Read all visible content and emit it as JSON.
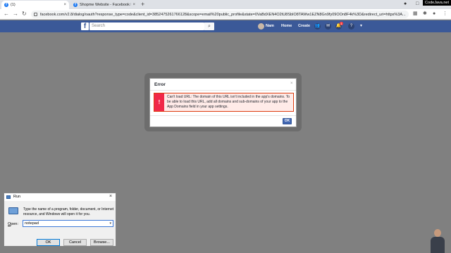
{
  "browser": {
    "tabs": [
      {
        "title": "(1)",
        "favicon": "facebook-icon"
      },
      {
        "title": "Shopme Website - Facebook Log",
        "favicon": "facebook-icon"
      }
    ],
    "new_tab_symbol": "+",
    "url_host": "facebook.com",
    "url_path": "/v2.8/dialog/oauth?response_type=code&client_id=3852475261766128&scope=email%20public_profile&state=0VaBdXEN4O2tU8SbIO8TAWw1EZN8Gn9fy09OOn8F4k%3D&redirect_uri=https%3A...",
    "watermark": "CodeJava.net"
  },
  "facebook": {
    "logo": "f",
    "search_placeholder": "Search",
    "user_name": "Nam",
    "nav_home": "Home",
    "nav_create": "Create",
    "notification_count": "1"
  },
  "error_dialog": {
    "title": "Error",
    "close_symbol": "×",
    "icon_symbol": "!",
    "message": "Can't load URL: The domain of this URL isn't included in the app's domains. To be able to load this URL, add all domains and sub-domains of your app to the App Domains field in your app settings.",
    "ok_label": "OK"
  },
  "run_dialog": {
    "title": "Run",
    "description": "Type the name of a program, folder, document, or Internet resource, and Windows will open it for you.",
    "open_label_prefix": "O",
    "open_label_rest": "pen:",
    "open_value": "notepad",
    "ok_label": "OK",
    "cancel_label": "Cancel",
    "browse_label": "Browse..."
  },
  "colors": {
    "facebook_blue": "#3b5998",
    "fb_button": "#4267b2",
    "error_red": "#f02849",
    "overlay": "#808080"
  }
}
